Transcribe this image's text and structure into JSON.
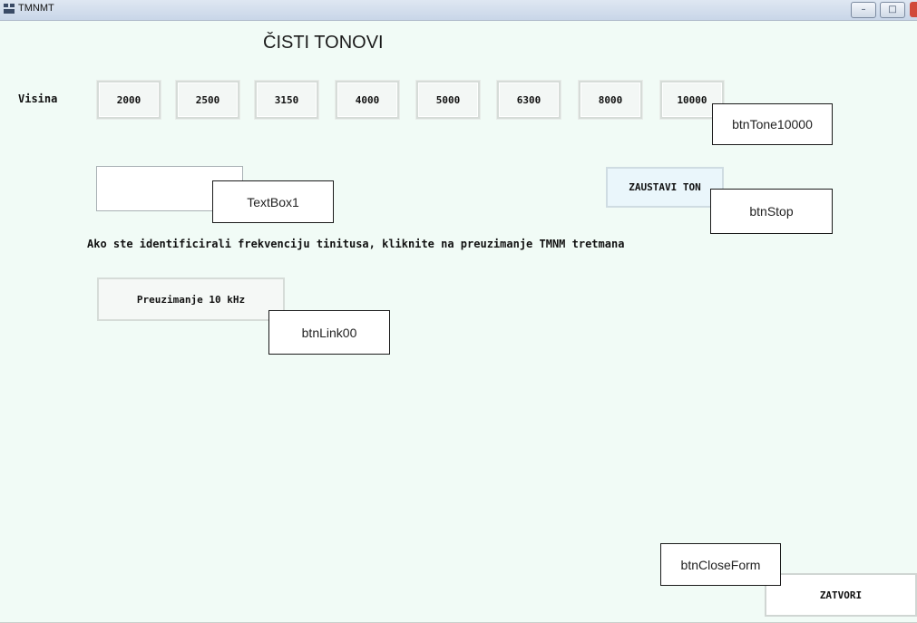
{
  "window": {
    "title": "TMNMT",
    "controls": {
      "minimize": "–",
      "maximize": "□"
    }
  },
  "form": {
    "heading": "ČISTI TONOVI",
    "pitch_label": "Visina",
    "tone_buttons": [
      "2000",
      "2500",
      "3150",
      "4000",
      "5000",
      "6300",
      "8000",
      "10000"
    ],
    "stop_button": "ZAUSTAVI TON",
    "instruction": "Ako ste identificirali frekvenciju tinitusa, kliknite na preuzimanje TMNM tretmana",
    "download_button": "Preuzimanje 10 kHz",
    "close_button": "ZATVORI"
  },
  "designer_tags": {
    "btn_tone_10000": "btnTone10000",
    "text_box_1": "TextBox1",
    "btn_stop": "btnStop",
    "btn_link_00": "btnLink00",
    "btn_close_form": "btnCloseForm"
  }
}
